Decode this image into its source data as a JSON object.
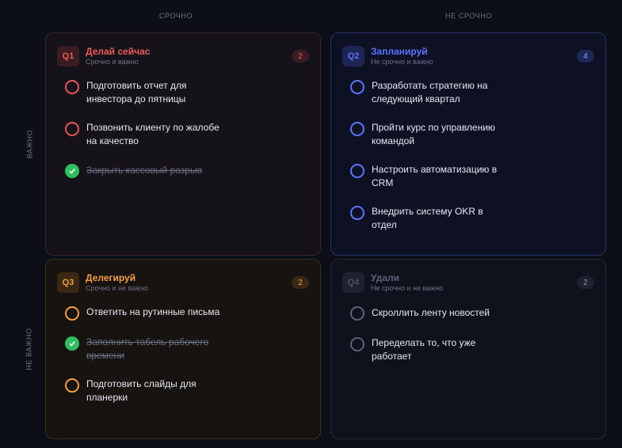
{
  "columns": {
    "urgent": "СРОЧНО",
    "not_urgent": "НЕ СРОЧНО"
  },
  "rows": {
    "important": "ВАЖНО",
    "not_important": "НЕ ВАЖНО"
  },
  "colors": {
    "q1": "#ef5a5a",
    "q2": "#5b74ff",
    "q3": "#f5a03d",
    "q4": "#5d6276",
    "done": "#2fbf5f"
  },
  "quadrants": [
    {
      "badge": "Q1",
      "title": "Делай сейчас",
      "subtitle": "Срочно и важно",
      "count": "2",
      "tasks": [
        {
          "text": "Подготовить отчет для инвестора до пятницы",
          "done": false
        },
        {
          "text": "Позвонить клиенту по жалобе на качество",
          "done": false
        },
        {
          "text": "Закрыть кассовый разрыв",
          "done": true
        }
      ]
    },
    {
      "badge": "Q2",
      "title": "Запланируй",
      "subtitle": "Не срочно и важно",
      "count": "4",
      "tasks": [
        {
          "text": "Разработать стратегию на следующий квартал",
          "done": false
        },
        {
          "text": "Пройти курс по управлению командой",
          "done": false
        },
        {
          "text": "Настроить автоматизацию в CRM",
          "done": false
        },
        {
          "text": "Внедрить систему OKR в отдел",
          "done": false
        }
      ]
    },
    {
      "badge": "Q3",
      "title": "Делегируй",
      "subtitle": "Срочно и не важно",
      "count": "2",
      "tasks": [
        {
          "text": "Ответить на рутинные письма",
          "done": false
        },
        {
          "text": "Заполнить табель рабочего времени",
          "done": true
        },
        {
          "text": "Подготовить слайды для планерки",
          "done": false
        }
      ]
    },
    {
      "badge": "Q4",
      "title": "Удали",
      "subtitle": "Не срочно и не важно",
      "count": "2",
      "tasks": [
        {
          "text": "Скроллить ленту новостей",
          "done": false
        },
        {
          "text": "Переделать то, что уже работает",
          "done": false
        }
      ]
    }
  ]
}
